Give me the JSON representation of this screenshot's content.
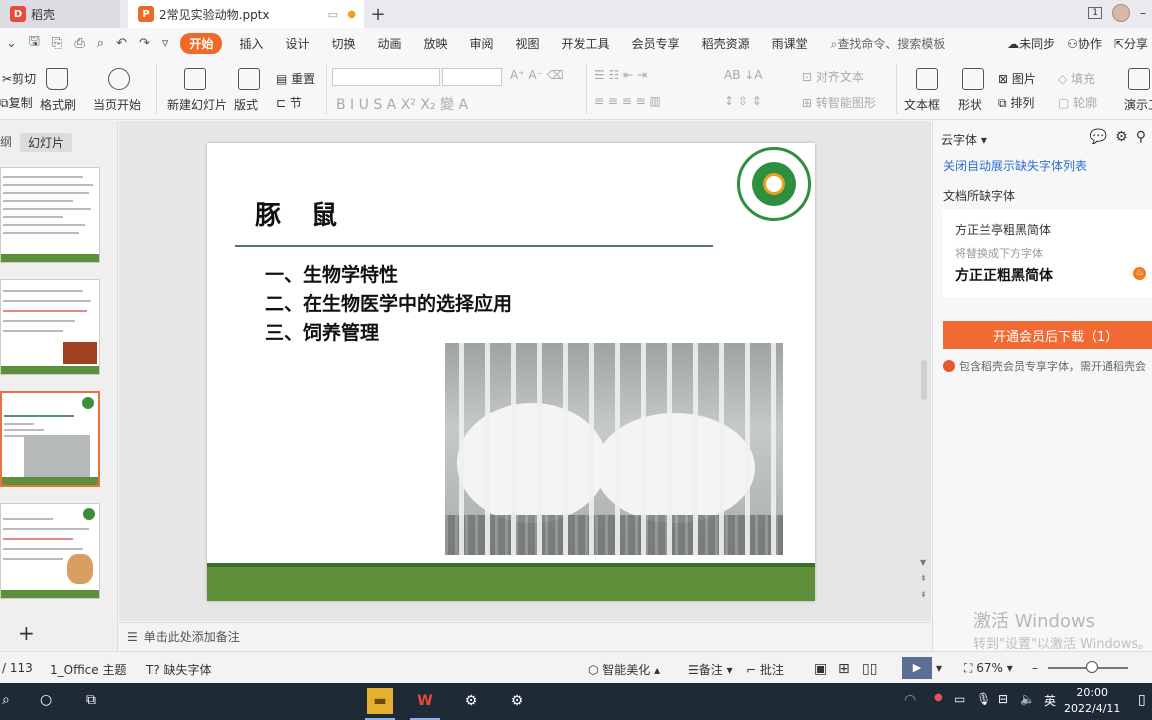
{
  "titlebar": {
    "home_tab": "稻壳",
    "doc_tab": "2常见实验动物.pptx",
    "page_box": "1"
  },
  "menu": {
    "items": [
      "开始",
      "插入",
      "设计",
      "切换",
      "动画",
      "放映",
      "审阅",
      "视图",
      "开发工具",
      "会员专享",
      "稻壳资源",
      "雨课堂"
    ],
    "search": "查找命令、搜索模板",
    "sync": "未同步",
    "collab": "协作",
    "share": "分享"
  },
  "ribbon": {
    "cut": "剪切",
    "copy": "复制",
    "format_painter": "格式刷",
    "play_from_current": "当页开始",
    "new_slide": "新建幻灯片",
    "layout": "版式",
    "reset": "重置",
    "section": "节",
    "align_text": "对齐文本",
    "smartart": "转智能图形",
    "textbox": "文本框",
    "shapes": "形状",
    "picture": "图片",
    "arrange": "排列",
    "fill": "填充",
    "outline": "轮廓",
    "presenter": "演示工"
  },
  "leftpanel": {
    "tab_outline": "纲",
    "tab_slides": "幻灯片"
  },
  "slide": {
    "title": "豚鼠",
    "bullets": [
      "一、生物学特性",
      "二、在生物医学中的选择应用",
      "三、饲养管理"
    ]
  },
  "notes_placeholder": "单击此处添加备注",
  "rightpane": {
    "header": "云字体",
    "link": "关闭自动展示缺失字体列表",
    "missing_label": "文档所缺字体",
    "missing_font": "方正兰亭粗黑简体",
    "replace_hint": "将替换成下方字体",
    "replacement_font": "方正正粗黑简体",
    "download_button": "开通会员后下载（1）",
    "member_note": "包含稻壳会员专享字体，需开通稻壳会",
    "watermark_title": "激活 Windows",
    "watermark_sub": "转到\"设置\"以激活 Windows。"
  },
  "statusbar": {
    "page": "/ 113",
    "theme": "1_Office 主题",
    "missing_font": "缺失字体",
    "smart_beautify": "智能美化",
    "notes": "备注",
    "comments": "批注",
    "zoom": "67%"
  },
  "taskbar": {
    "ime": "英",
    "time": "20:00",
    "date": "2022/4/11"
  },
  "colors": {
    "accent": "#ef6a28",
    "slide_band": "#5f8f3a",
    "link": "#2a6fd0"
  }
}
